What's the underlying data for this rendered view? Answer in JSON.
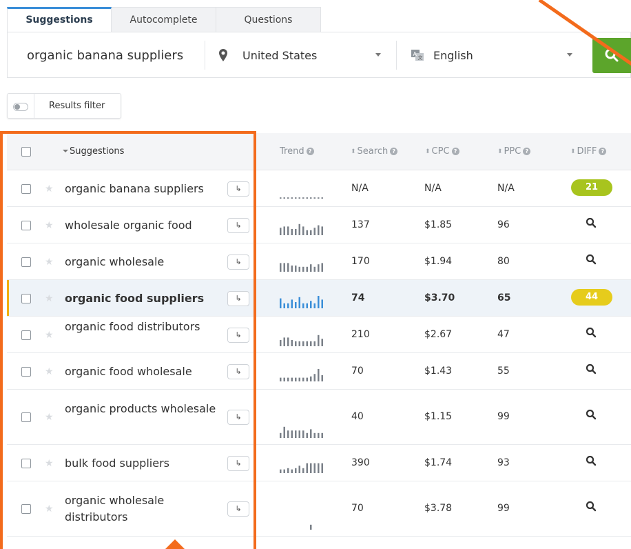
{
  "tabs": [
    {
      "label": "Suggestions",
      "active": true
    },
    {
      "label": "Autocomplete",
      "active": false
    },
    {
      "label": "Questions",
      "active": false
    }
  ],
  "search": {
    "keyword": "organic banana suppliers",
    "location": "United States",
    "language": "English"
  },
  "filter": {
    "label": "Results filter"
  },
  "table": {
    "headers": {
      "suggestions": "Suggestions",
      "trend": "Trend",
      "search": "Search",
      "cpc": "CPC",
      "ppc": "PPC",
      "diff": "DIFF"
    },
    "rows": [
      {
        "keyword": "organic banana suppliers",
        "search": "N/A",
        "cpc": "N/A",
        "ppc": "N/A",
        "diff": "21",
        "diff_color": "#a8c41e",
        "trend": [
          1,
          1,
          1,
          1,
          1,
          1,
          1,
          1,
          1,
          1,
          1,
          1
        ],
        "highlight": false
      },
      {
        "keyword": "wholesale organic food",
        "search": "137",
        "cpc": "$1.85",
        "ppc": "96",
        "diff": "",
        "trend": [
          6,
          7,
          7,
          5,
          5,
          9,
          7,
          4,
          4,
          6,
          8,
          7
        ],
        "highlight": false
      },
      {
        "keyword": "organic wholesale",
        "search": "170",
        "cpc": "$1.94",
        "ppc": "80",
        "diff": "",
        "trend": [
          7,
          7,
          7,
          5,
          5,
          4,
          4,
          4,
          6,
          4,
          6,
          7
        ],
        "highlight": false
      },
      {
        "keyword": "organic food suppliers",
        "search": "74",
        "cpc": "$3.70",
        "ppc": "65",
        "diff": "44",
        "diff_color": "#e6cc1c",
        "trend": [
          8,
          4,
          4,
          7,
          5,
          9,
          4,
          4,
          6,
          4,
          10,
          7
        ],
        "highlight": true
      },
      {
        "keyword": "organic food distributors",
        "search": "210",
        "cpc": "$2.67",
        "ppc": "47",
        "diff": "",
        "trend": [
          5,
          7,
          7,
          5,
          4,
          4,
          4,
          4,
          4,
          4,
          9,
          6
        ],
        "highlight": false
      },
      {
        "keyword": "organic food wholesale",
        "search": "70",
        "cpc": "$1.43",
        "ppc": "55",
        "diff": "",
        "trend": [
          3,
          3,
          3,
          3,
          3,
          3,
          3,
          3,
          4,
          6,
          10,
          5
        ],
        "highlight": false
      },
      {
        "keyword": "organic products wholesale",
        "search": "40",
        "cpc": "$1.15",
        "ppc": "99",
        "diff": "",
        "trend": [
          4,
          9,
          6,
          6,
          6,
          6,
          6,
          4,
          7,
          4,
          4,
          4
        ],
        "highlight": false
      },
      {
        "keyword": "bulk food suppliers",
        "search": "390",
        "cpc": "$1.74",
        "ppc": "93",
        "diff": "",
        "trend": [
          3,
          3,
          4,
          3,
          4,
          6,
          4,
          8,
          8,
          8,
          8,
          8
        ],
        "highlight": false
      },
      {
        "keyword": "organic wholesale distributors",
        "search": "70",
        "cpc": "$3.78",
        "ppc": "99",
        "diff": "",
        "trend": [
          0,
          0,
          0,
          0,
          0,
          0,
          0,
          0,
          4,
          0,
          0,
          0
        ],
        "highlight": false
      }
    ]
  },
  "icons": {
    "location": "map-pin-icon",
    "language": "language-icon",
    "go": "search-icon",
    "row_diff": "search-icon",
    "star": "star-icon",
    "send": "arrow-return-icon"
  },
  "colors": {
    "accent_blue": "#3a8ed8",
    "go_green": "#5ca52b",
    "annotation_orange": "#f36b1c",
    "highlight_bar": "#f2b000"
  }
}
